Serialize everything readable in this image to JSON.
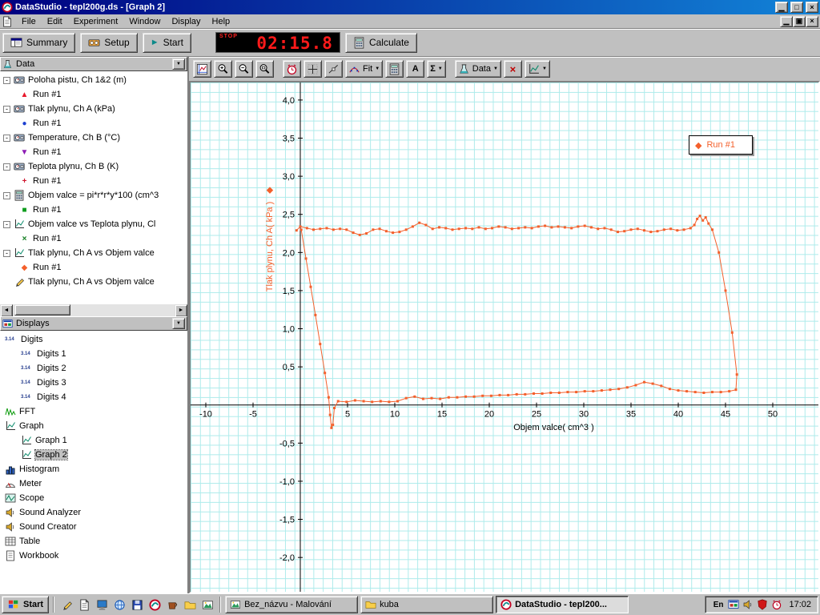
{
  "window": {
    "title": "DataStudio - tepl200g.ds - [Graph 2]"
  },
  "menu_bar": {
    "items": [
      "File",
      "Edit",
      "Experiment",
      "Window",
      "Display",
      "Help"
    ]
  },
  "main_toolbar": {
    "summary_label": "Summary",
    "setup_label": "Setup",
    "start_label": "Start",
    "timer_stop_label": "STOP",
    "timer_value": "02:15.8",
    "calculate_label": "Calculate"
  },
  "graph_toolbar": {
    "fit_label": "Fit",
    "text_tool_label": "A",
    "stats_label": "Σ",
    "data_label": "Data"
  },
  "data_panel": {
    "header_label": "Data",
    "channels": [
      {
        "label": "Poloha pistu, Ch 1&2 (m)",
        "icon": "sensor-icon",
        "runs": [
          {
            "label": "Run #1",
            "marker": "▲",
            "color": "#e8192c"
          }
        ]
      },
      {
        "label": "Tlak plynu, Ch A (kPa)",
        "icon": "sensor-icon",
        "runs": [
          {
            "label": "Run #1",
            "marker": "●",
            "color": "#1b3fd0"
          }
        ]
      },
      {
        "label": "Temperature, Ch B (°C)",
        "icon": "sensor-icon",
        "runs": [
          {
            "label": "Run #1",
            "marker": "▼",
            "color": "#8c1bb4"
          }
        ]
      },
      {
        "label": "Teplota plynu, Ch B (K)",
        "icon": "sensor-icon",
        "runs": [
          {
            "label": "Run #1",
            "marker": "+",
            "color": "#d01830"
          }
        ]
      },
      {
        "label": "Objem valce = pi*r*r*y*100 (cm^3",
        "icon": "calculator-icon",
        "runs": [
          {
            "label": "Run #1",
            "marker": "■",
            "color": "#0f9c1e"
          }
        ]
      },
      {
        "label": "Objem valce vs Teplota plynu, Cl",
        "icon": "xy-icon",
        "runs": [
          {
            "label": "Run #1",
            "marker": "×",
            "color": "#0f7c1e"
          }
        ]
      },
      {
        "label": "Tlak plynu, Ch A vs Objem valce",
        "icon": "xy-icon",
        "runs": [
          {
            "label": "Run #1",
            "marker": "◆",
            "color": "#f4602c"
          }
        ]
      },
      {
        "label": "Tlak plynu, Ch A vs Objem valce",
        "icon": "pen-icon",
        "runs": []
      }
    ]
  },
  "displays_panel": {
    "header_label": "Displays",
    "digits_glyph": "3.14",
    "items": [
      {
        "label": "Digits",
        "icon": "digits-icon",
        "indent": 0
      },
      {
        "label": "Digits 1",
        "icon": "digits-icon",
        "indent": 1
      },
      {
        "label": "Digits 2",
        "icon": "digits-icon",
        "indent": 1
      },
      {
        "label": "Digits 3",
        "icon": "digits-icon",
        "indent": 1
      },
      {
        "label": "Digits 4",
        "icon": "digits-icon",
        "indent": 1
      },
      {
        "label": "FFT",
        "icon": "fft-icon",
        "indent": 0
      },
      {
        "label": "Graph",
        "icon": "graph-icon",
        "indent": 0
      },
      {
        "label": "Graph 1",
        "icon": "graph-icon",
        "indent": 1
      },
      {
        "label": "Graph 2",
        "icon": "graph-icon",
        "indent": 1,
        "selected": true
      },
      {
        "label": "Histogram",
        "icon": "histogram-icon",
        "indent": 0
      },
      {
        "label": "Meter",
        "icon": "meter-icon",
        "indent": 0
      },
      {
        "label": "Scope",
        "icon": "scope-icon",
        "indent": 0
      },
      {
        "label": "Sound Analyzer",
        "icon": "speaker-icon",
        "indent": 0
      },
      {
        "label": "Sound Creator",
        "icon": "speaker-icon",
        "indent": 0
      },
      {
        "label": "Table",
        "icon": "table-icon",
        "indent": 0
      },
      {
        "label": "Workbook",
        "icon": "workbook-icon",
        "indent": 0
      }
    ]
  },
  "chart_data": {
    "type": "scatter",
    "title": "",
    "xlabel": "Objem valce( cm^3 )",
    "ylabel": "Tlak plynu, Ch A( kPa )",
    "xlim": [
      -11.61,
      54.83
    ],
    "ylim": [
      -2.45,
      4.23
    ],
    "grid": true,
    "grid_color": "#aeebeb",
    "series_color": "#f4602c",
    "x_ticks": [
      -10,
      -5,
      5,
      10,
      15,
      20,
      25,
      30,
      35,
      40,
      45,
      50
    ],
    "x_tick_labels": [
      "-10",
      "-5",
      "5",
      "10",
      "15",
      "20",
      "25",
      "30",
      "35",
      "40",
      "45",
      "50"
    ],
    "y_ticks": [
      4,
      3.5,
      3,
      2.5,
      2,
      1.5,
      1,
      0.5,
      -0.5,
      -1,
      -1.5,
      -2
    ],
    "y_tick_labels": [
      "4,0",
      "3,5",
      "3,0",
      "2,5",
      "2,0",
      "1,5",
      "1,0",
      "0,5",
      "-0,5",
      "-1,0",
      "-1,5",
      "-2,0"
    ],
    "legend": {
      "label": "Run #1",
      "marker_glyph": "◆",
      "position": "top-right"
    },
    "series": [
      {
        "name": "Run #1",
        "marker": "diamond",
        "x": [
          0.1,
          0.6,
          1.1,
          1.6,
          2.1,
          2.6,
          3.0,
          3.15,
          3.3,
          3.45,
          3.6,
          4.0,
          4.9,
          5.8,
          6.7,
          7.6,
          8.5,
          9.4,
          10.3,
          11.2,
          12.1,
          13.0,
          13.9,
          14.8,
          15.7,
          16.6,
          17.5,
          18.4,
          19.3,
          20.2,
          21.1,
          22.0,
          22.9,
          23.8,
          24.7,
          25.6,
          26.5,
          27.4,
          28.3,
          29.2,
          30.1,
          31.0,
          31.9,
          32.8,
          33.7,
          34.6,
          35.5,
          36.4,
          37.3,
          38.2,
          39.1,
          40.0,
          40.9,
          41.8,
          42.7,
          43.6,
          44.5,
          45.4,
          46.1,
          46.2,
          45.7,
          45.0,
          44.3,
          43.6,
          43.2,
          42.9,
          42.6,
          42.3,
          42.0,
          41.7,
          41.3,
          40.6,
          39.9,
          39.2,
          38.5,
          37.8,
          37.1,
          36.4,
          35.7,
          35.0,
          34.3,
          33.6,
          32.9,
          32.2,
          31.5,
          30.8,
          30.1,
          29.4,
          28.7,
          28.0,
          27.3,
          26.6,
          25.9,
          25.2,
          24.5,
          23.8,
          23.1,
          22.4,
          21.7,
          21.0,
          20.3,
          19.6,
          18.9,
          18.2,
          17.5,
          16.8,
          16.1,
          15.4,
          14.7,
          14.0,
          13.3,
          12.6,
          11.9,
          11.2,
          10.5,
          9.8,
          9.1,
          8.4,
          7.7,
          7.0,
          6.3,
          5.6,
          4.9,
          4.2,
          3.5,
          2.8,
          2.1,
          1.4,
          0.7,
          0.0,
          -0.4
        ],
        "y": [
          2.3,
          1.92,
          1.55,
          1.18,
          0.8,
          0.42,
          0.1,
          -0.13,
          -0.3,
          -0.26,
          -0.04,
          0.05,
          0.04,
          0.06,
          0.05,
          0.04,
          0.05,
          0.04,
          0.05,
          0.09,
          0.11,
          0.08,
          0.09,
          0.08,
          0.1,
          0.1,
          0.11,
          0.11,
          0.12,
          0.12,
          0.13,
          0.13,
          0.14,
          0.14,
          0.15,
          0.15,
          0.16,
          0.16,
          0.17,
          0.17,
          0.18,
          0.18,
          0.19,
          0.2,
          0.21,
          0.23,
          0.26,
          0.3,
          0.28,
          0.25,
          0.21,
          0.19,
          0.18,
          0.17,
          0.16,
          0.17,
          0.17,
          0.18,
          0.2,
          0.4,
          0.95,
          1.5,
          2.0,
          2.3,
          2.38,
          2.46,
          2.42,
          2.48,
          2.44,
          2.36,
          2.32,
          2.3,
          2.29,
          2.31,
          2.3,
          2.28,
          2.27,
          2.29,
          2.31,
          2.3,
          2.28,
          2.27,
          2.3,
          2.32,
          2.31,
          2.33,
          2.35,
          2.34,
          2.32,
          2.33,
          2.34,
          2.33,
          2.35,
          2.34,
          2.32,
          2.33,
          2.32,
          2.31,
          2.33,
          2.34,
          2.32,
          2.31,
          2.33,
          2.31,
          2.32,
          2.31,
          2.3,
          2.32,
          2.33,
          2.31,
          2.36,
          2.39,
          2.34,
          2.3,
          2.27,
          2.26,
          2.28,
          2.31,
          2.3,
          2.25,
          2.23,
          2.26,
          2.3,
          2.31,
          2.3,
          2.32,
          2.31,
          2.3,
          2.32,
          2.34,
          2.29
        ]
      }
    ]
  },
  "taskbar": {
    "start_label": "Start",
    "tasks": [
      {
        "label": "Bez_názvu - Malování",
        "icon": "paint",
        "active": false
      },
      {
        "label": "kuba",
        "icon": "folder",
        "active": false
      },
      {
        "label": "DataStudio - tepl200...",
        "icon": "datastudio",
        "active": true
      }
    ],
    "tray": {
      "lang": "En",
      "clock": "17:02"
    }
  }
}
